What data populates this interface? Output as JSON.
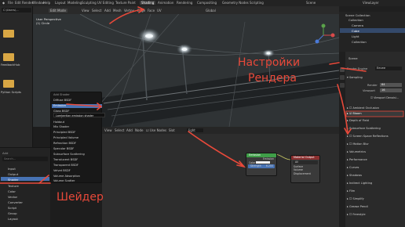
{
  "topbar": {
    "menus": [
      "File",
      "Edit",
      "Render",
      "Window",
      "Help"
    ],
    "tabs": [
      "Layout",
      "Modeling",
      "Sculpting",
      "UV Editing",
      "Texture Paint",
      "Shading",
      "Animation",
      "Rendering",
      "Compositing",
      "Geometry Nodes",
      "Scripting"
    ],
    "active_tab": "Shading",
    "scene_label": "Scene",
    "view_layer": "ViewLayer"
  },
  "left_col": {
    "path": "C:\\Users\\...",
    "files": [
      "",
      "FeedbackHub",
      "",
      "Python Scripts"
    ]
  },
  "viewport": {
    "mode": "Edit Mode",
    "menus": [
      "View",
      "Select",
      "Add",
      "Mesh",
      "Vertex",
      "Edge",
      "Face",
      "UV"
    ],
    "transform": "Global",
    "info_line1": "User Perspective",
    "info_line2": "(1) Circle"
  },
  "node_editor": {
    "menus": [
      "View",
      "Select",
      "Add",
      "Node"
    ],
    "use_nodes_label": "Use Nodes",
    "slot": "Slot",
    "material": "light"
  },
  "context_menu": {
    "items": [
      "Add Shader",
      "Diffuse BSDF",
      "Emission",
      "Glass BSDF",
      "Glossy BSDF",
      "Holdout",
      "Mix Shader",
      "Principled BSDF",
      "Principled Volume",
      "Refraction BSDF",
      "Specular BSDF",
      "Subsurface Scattering",
      "Translucent BSDF",
      "Transparent BSDF",
      "Velvet BSDF",
      "Volume Absorption",
      "Volume Scatter"
    ],
    "highlighted": "Emission",
    "tooltip": "Lambertian emission shader"
  },
  "add_panel": {
    "title": "Add",
    "search_placeholder": "Search...",
    "items": [
      "Input",
      "Output",
      "Shader",
      "Texture",
      "Color",
      "Vector",
      "Converter",
      "Script",
      "Group",
      "Layout"
    ],
    "selected": "Shader"
  },
  "nodes": {
    "emission": {
      "title": "Emission",
      "output": "Emission",
      "color_label": "Color",
      "strength_label": "Strength",
      "strength_value": "6.200"
    },
    "material_output": {
      "title": "Material Output",
      "target": "All",
      "inputs": [
        "Surface",
        "Volume",
        "Displacement"
      ]
    }
  },
  "outliner": {
    "title": "Scene Collection",
    "items": [
      "Collection",
      "Camera",
      "Cube",
      "Light",
      "Collection"
    ]
  },
  "properties": {
    "scene_label": "Scene",
    "render_engine_label": "Render Engine",
    "render_engine": "Eevee",
    "sampling": "Sampling",
    "render_label": "Render",
    "render_value": "64",
    "viewport_label": "Viewport",
    "viewport_value": "16",
    "viewport_denoising": "Viewport Denoisi...",
    "sections": [
      "Ambient Occlusion",
      "Bloom",
      "Depth of Field",
      "Subsurface Scattering",
      "Screen Space Reflections",
      "Motion Blur",
      "Volumetrics",
      "Performance",
      "Curves",
      "Shadows",
      "Indirect Lighting",
      "Film",
      "Simplify",
      "Grease Pencil",
      "Freestyle"
    ]
  },
  "annotations": {
    "render_settings": [
      "Настройки",
      "Рендера"
    ],
    "shader": "Шейдер"
  },
  "colors": {
    "accent_blue": "#4772b3",
    "annotation_red": "#e8493a",
    "emission_header": "#3f9e48",
    "output_header": "#8a2f2f",
    "folder_yellow": "#d9a744"
  }
}
